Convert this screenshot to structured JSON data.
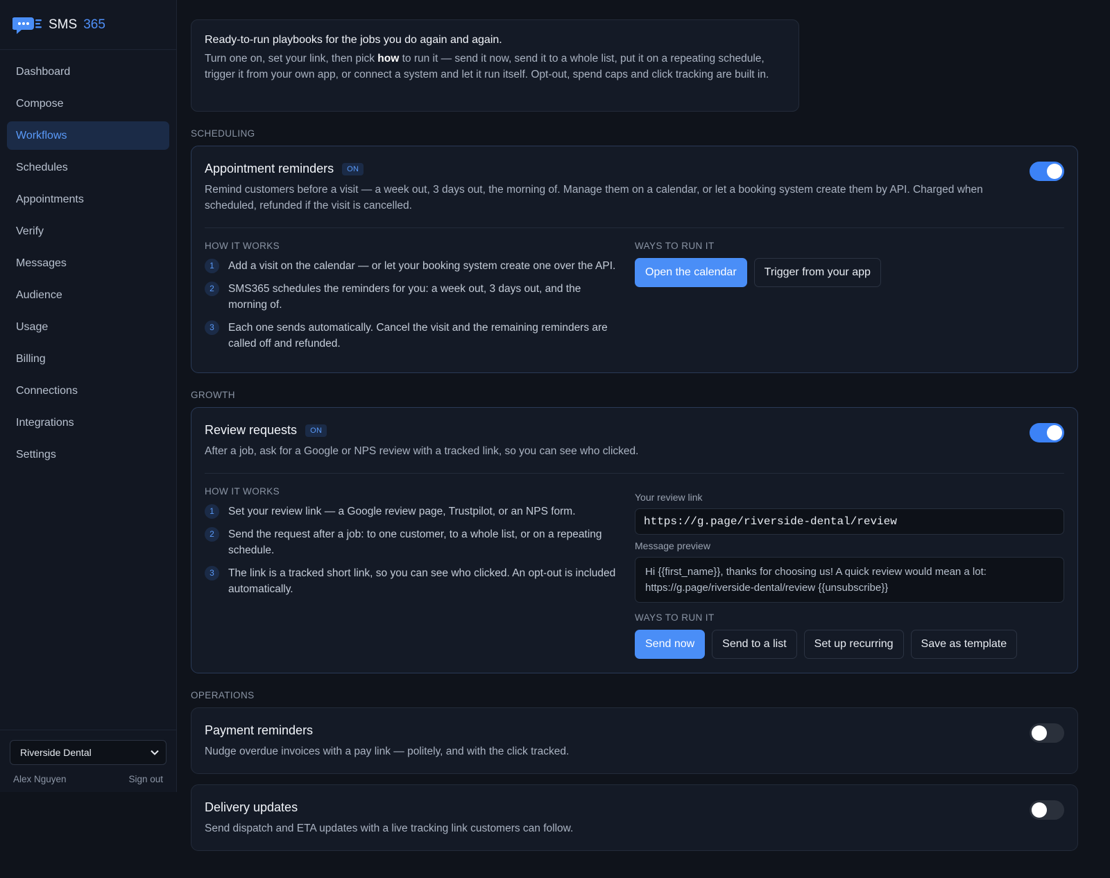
{
  "brand": {
    "name": "SMS",
    "number": "365"
  },
  "nav": [
    {
      "label": "Dashboard"
    },
    {
      "label": "Compose"
    },
    {
      "label": "Workflows",
      "active": true
    },
    {
      "label": "Schedules"
    },
    {
      "label": "Appointments"
    },
    {
      "label": "Verify"
    },
    {
      "label": "Messages"
    },
    {
      "label": "Audience"
    },
    {
      "label": "Usage"
    },
    {
      "label": "Billing"
    },
    {
      "label": "Connections"
    },
    {
      "label": "Integrations"
    },
    {
      "label": "Settings"
    }
  ],
  "footer": {
    "org": "Riverside Dental",
    "user": "Alex Nguyen",
    "signout": "Sign out"
  },
  "intro": {
    "title": "Ready-to-run playbooks for the jobs you do again and again.",
    "body_pre": "Turn one on, set your link, then pick ",
    "body_bold": "how",
    "body_post": " to run it — send it now, send it to a whole list, put it on a repeating schedule, trigger it from your own app, or connect a system and let it run itself. Opt-out, spend caps and click tracking are built in."
  },
  "sections": {
    "scheduling": "SCHEDULING",
    "growth": "GROWTH",
    "operations": "OPERATIONS"
  },
  "appointment": {
    "title": "Appointment reminders",
    "badge": "ON",
    "desc": "Remind customers before a visit — a week out, 3 days out, the morning of. Manage them on a calendar, or let a booking system create them by API. Charged when scheduled, refunded if the visit is cancelled.",
    "how_label": "HOW IT WORKS",
    "steps": [
      {
        "num": "1",
        "text": "Add a visit on the calendar — or let your booking system create one over the API."
      },
      {
        "num": "2",
        "text": "SMS365 schedules the reminders for you: a week out, 3 days out, and the morning of."
      },
      {
        "num": "3",
        "text": "Each one sends automatically. Cancel the visit and the remaining reminders are called off and refunded."
      }
    ],
    "ways_label": "WAYS TO RUN IT",
    "btn_calendar": "Open the calendar",
    "btn_trigger": "Trigger from your app"
  },
  "review": {
    "title": "Review requests",
    "badge": "ON",
    "desc": "After a job, ask for a Google or NPS review with a tracked link, so you can see who clicked.",
    "how_label": "HOW IT WORKS",
    "steps": [
      {
        "num": "1",
        "text": "Set your review link — a Google review page, Trustpilot, or an NPS form."
      },
      {
        "num": "2",
        "text": "Send the request after a job: to one customer, to a whole list, or on a repeating schedule."
      },
      {
        "num": "3",
        "text": "The link is a tracked short link, so you can see who clicked. An opt-out is included automatically."
      }
    ],
    "link_label": "Your review link",
    "link_value": "https://g.page/riverside-dental/review",
    "preview_label": "Message preview",
    "preview_text": "Hi {{first_name}}, thanks for choosing us! A quick review would mean a lot: https://g.page/riverside-dental/review {{unsubscribe}}",
    "ways_label": "WAYS TO RUN IT",
    "btn_send_now": "Send now",
    "btn_send_list": "Send to a list",
    "btn_recurring": "Set up recurring",
    "btn_template": "Save as template"
  },
  "payment": {
    "title": "Payment reminders",
    "desc": "Nudge overdue invoices with a pay link — politely, and with the click tracked."
  },
  "delivery": {
    "title": "Delivery updates",
    "desc": "Send dispatch and ETA updates with a live tracking link customers can follow."
  },
  "colors": {
    "accent": "#4a8ef7",
    "background": "#0f131b",
    "card": "#141a26"
  }
}
